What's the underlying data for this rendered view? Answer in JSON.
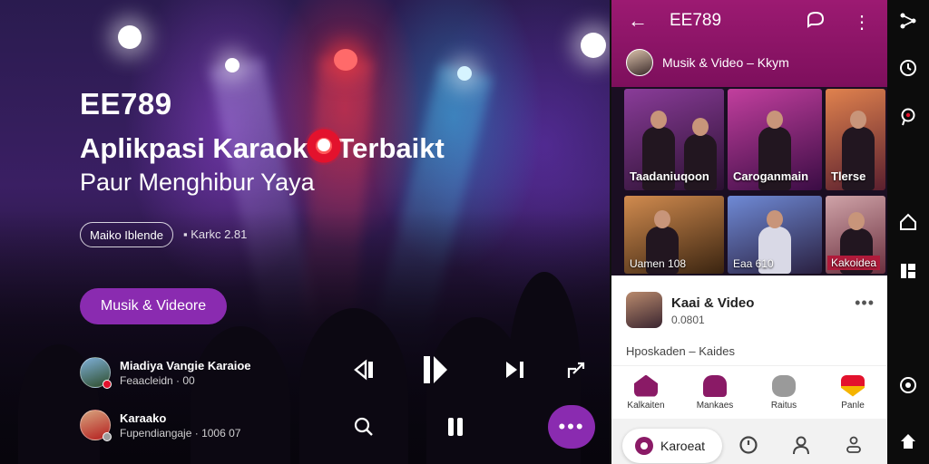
{
  "hero": {
    "brand": "EE789",
    "headline_left": "Aplikpasi Karaok",
    "headline_right": "Terbaikt",
    "subtitle": "Paur Menghibur Yaya",
    "tag_outline": "Maiko Iblende",
    "tag_meta": "Karkc 2.81",
    "cta_label": "Musik & Videore",
    "tracks": [
      {
        "title": "Miadiya Vangie Karaioe",
        "meta": "Feaacleidn · 00"
      },
      {
        "title": "Karaako",
        "meta": "Fupendiangaje · 1006 07"
      }
    ],
    "controls": {
      "rewind_icon": "rewind-icon",
      "play_icon": "play-pause-icon",
      "next_icon": "skip-next-icon",
      "share_icon": "share-icon",
      "search_icon": "search-icon",
      "pause_icon": "pause-icon",
      "more_icon": "more-horizontal-icon"
    }
  },
  "app": {
    "title": "EE789",
    "subheader": "Musik & Video – Kkym",
    "tiles": [
      {
        "caption": "Taadaniuqoon"
      },
      {
        "caption": "Caroganmain"
      },
      {
        "caption": "Tlerse"
      },
      {
        "caption": "Uamen 108"
      },
      {
        "caption": "Eaa 610"
      },
      {
        "caption": "Kakoidea"
      }
    ],
    "card": {
      "title": "Kaai & Video",
      "subtitle": "0.0801",
      "line": "Hposkaden – Kaides"
    },
    "categories": [
      {
        "label": "Kalkaiten",
        "color": "#8a1a66"
      },
      {
        "label": "Mankaes",
        "color": "#8a1a66"
      },
      {
        "label": "Raitus",
        "color": "#9a9a9a"
      },
      {
        "label": "Panle",
        "color": "#e3122d"
      }
    ],
    "bottom_nav": {
      "active_label": "Karoeat"
    }
  },
  "colors": {
    "accent": "#8a2bb0",
    "brand": "#8a1a66",
    "red": "#e3122d"
  }
}
